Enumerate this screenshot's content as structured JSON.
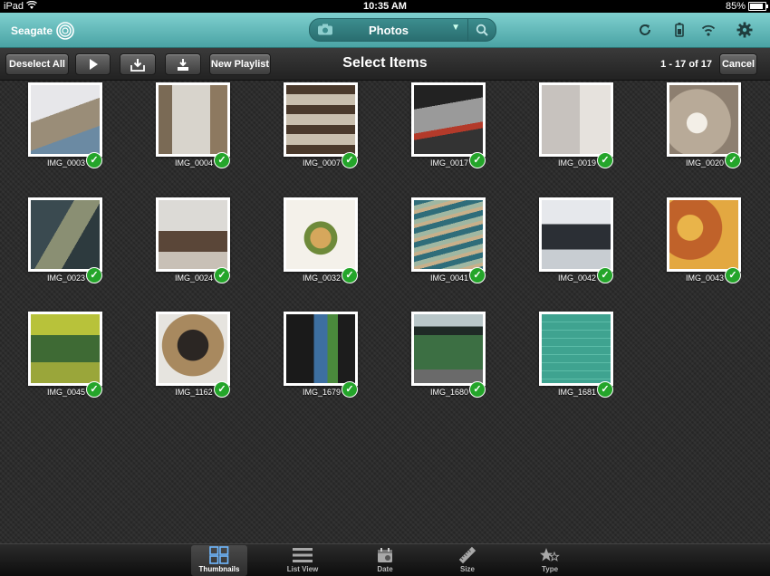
{
  "status_bar": {
    "device": "iPad",
    "time": "10:35 AM",
    "battery": "85%",
    "battery_level": 0.85
  },
  "header": {
    "logo_text": "Seagate",
    "source": "Photos",
    "accent_color": "#5fb8b8"
  },
  "toolbar": {
    "deselect_all": "Deselect All",
    "new_playlist": "New Playlist",
    "title": "Select Items",
    "count": "1 - 17 of 17",
    "cancel": "Cancel"
  },
  "thumbnails": [
    {
      "label": "IMG_0003",
      "selected": true
    },
    {
      "label": "IMG_0004",
      "selected": true
    },
    {
      "label": "IMG_0007",
      "selected": true
    },
    {
      "label": "IMG_0017",
      "selected": true
    },
    {
      "label": "IMG_0019",
      "selected": true
    },
    {
      "label": "IMG_0020",
      "selected": true
    },
    {
      "label": "IMG_0023",
      "selected": true
    },
    {
      "label": "IMG_0024",
      "selected": true
    },
    {
      "label": "IMG_0032",
      "selected": true
    },
    {
      "label": "IMG_0041",
      "selected": true
    },
    {
      "label": "IMG_0042",
      "selected": true
    },
    {
      "label": "IMG_0043",
      "selected": true
    },
    {
      "label": "IMG_0045",
      "selected": true
    },
    {
      "label": "IMG_1162",
      "selected": true
    },
    {
      "label": "IMG_1679",
      "selected": true
    },
    {
      "label": "IMG_1680",
      "selected": true
    },
    {
      "label": "IMG_1681",
      "selected": true
    }
  ],
  "tabs": [
    {
      "label": "Thumbnails",
      "icon": "grid-icon",
      "active": true
    },
    {
      "label": "List View",
      "icon": "list-icon",
      "active": false
    },
    {
      "label": "Date",
      "icon": "calendar-icon",
      "active": false
    },
    {
      "label": "Size",
      "icon": "ruler-icon",
      "active": false
    },
    {
      "label": "Type",
      "icon": "stars-icon",
      "active": false
    }
  ]
}
